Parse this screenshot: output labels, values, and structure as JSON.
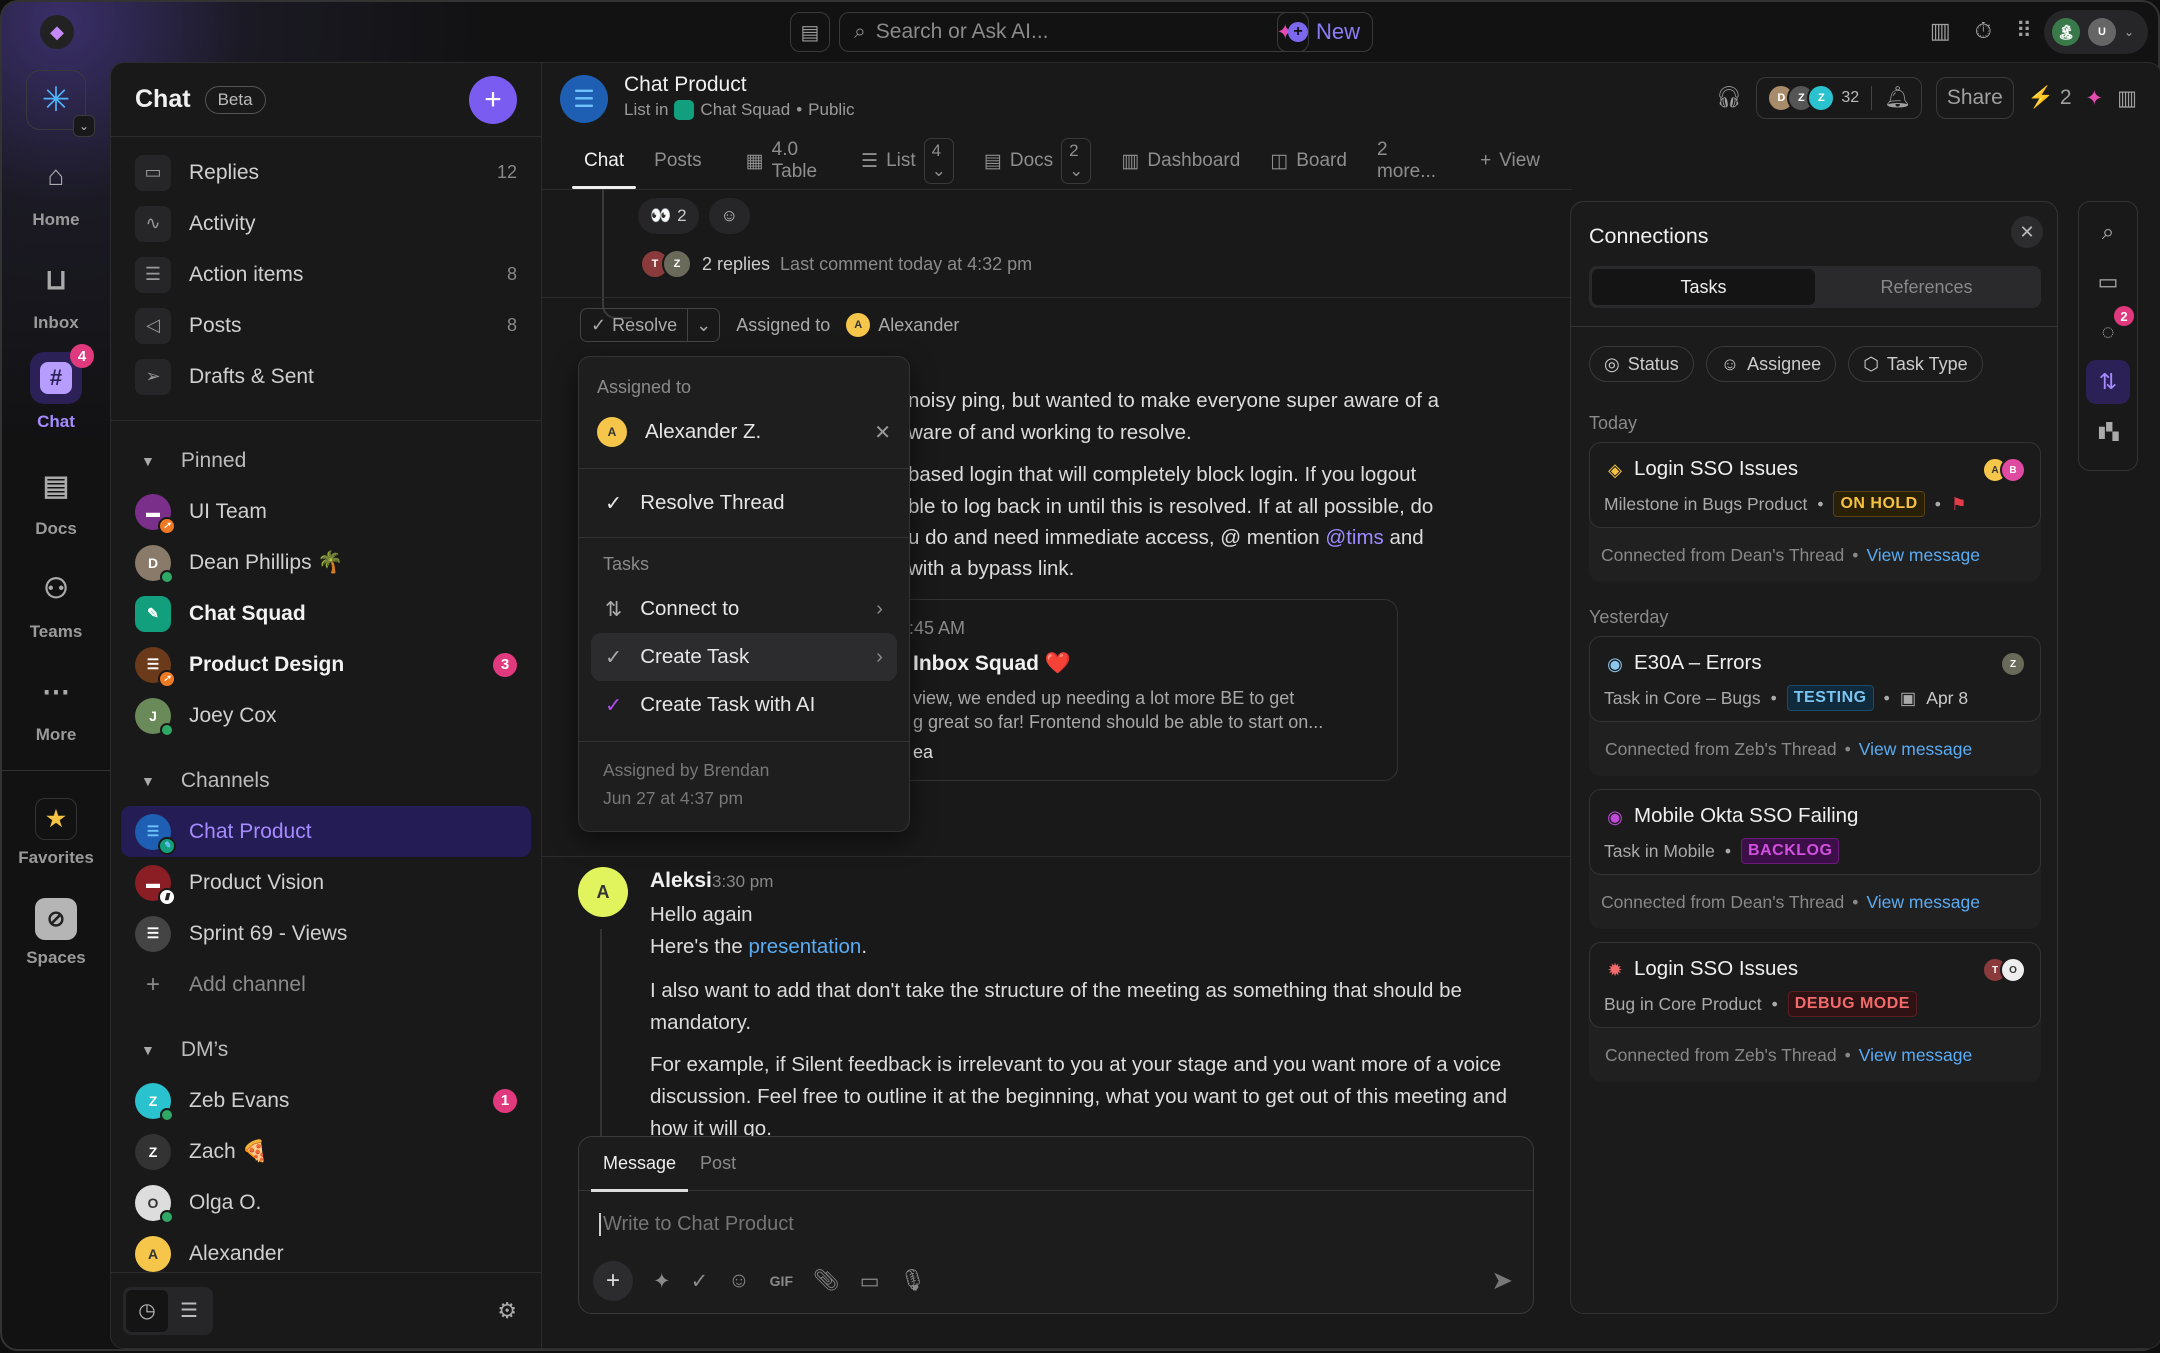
{
  "topbar": {
    "search_placeholder": "Search or Ask AI...",
    "new_label": "New"
  },
  "rail": {
    "items": [
      {
        "label": "Home",
        "icon": "home-icon"
      },
      {
        "label": "Inbox",
        "icon": "inbox-icon"
      },
      {
        "label": "Chat",
        "icon": "hash-icon",
        "badge": "4"
      },
      {
        "label": "Docs",
        "icon": "doc-icon"
      },
      {
        "label": "Teams",
        "icon": "teams-icon"
      },
      {
        "label": "More",
        "icon": "more-icon"
      }
    ],
    "favorites_label": "Favorites",
    "spaces_label": "Spaces"
  },
  "sidebar": {
    "title": "Chat",
    "beta_label": "Beta",
    "nav": [
      {
        "label": "Replies",
        "count": "12"
      },
      {
        "label": "Activity",
        "count": ""
      },
      {
        "label": "Action items",
        "count": "8"
      },
      {
        "label": "Posts",
        "count": "8"
      },
      {
        "label": "Drafts & Sent",
        "count": ""
      }
    ],
    "pinned_label": "Pinned",
    "pinned": [
      {
        "label": "UI Team"
      },
      {
        "label": "Dean Phillips 🌴"
      },
      {
        "label": "Chat Squad"
      },
      {
        "label": "Product Design",
        "badge": "3"
      },
      {
        "label": "Joey Cox"
      }
    ],
    "channels_label": "Channels",
    "channels": [
      {
        "label": "Chat Product"
      },
      {
        "label": "Product Vision"
      },
      {
        "label": "Sprint 69 - Views"
      }
    ],
    "add_channel_label": "Add channel",
    "dms_label": "DM’s",
    "dms": [
      {
        "label": "Zeb Evans",
        "badge": "1"
      },
      {
        "label": "Zach 🍕"
      },
      {
        "label": "Olga O."
      },
      {
        "label": "Alexander"
      }
    ]
  },
  "header": {
    "title": "Chat Product",
    "crumb_prefix": "List in",
    "crumb_space": "Chat Squad",
    "crumb_visibility": "Public",
    "member_count": "32",
    "share_label": "Share",
    "ai_count": "2"
  },
  "tabs": [
    {
      "label": "Chat",
      "active": true
    },
    {
      "label": "Posts"
    },
    {
      "label": "4.0 Table"
    },
    {
      "label": "List",
      "count": "4"
    },
    {
      "label": "Docs",
      "count": "2"
    },
    {
      "label": "Dashboard"
    },
    {
      "label": "Board"
    },
    {
      "label": "2 more..."
    },
    {
      "label": "View"
    }
  ],
  "thread": {
    "reaction_count": "2",
    "replies_label": "2 replies",
    "last_comment": "Last comment today at 4:32 pm",
    "resolve_label": "Resolve",
    "assigned_to_label": "Assigned to",
    "assignee": "Alexander",
    "body_lines": [
      "noisy ping, but wanted to make everyone super aware of a",
      "ware of and working to resolve.",
      "based login that will completely block login. If you logout",
      "ble to log back in until this is resolved. If at all possible, do",
      "u do and need immediate access, @ mention",
      "with a bypass link."
    ],
    "mention": "@tims",
    "mention_after": " and",
    "card": {
      "time": ":45 AM",
      "title": "Inbox Squad ❤️",
      "line1": "view, we ended up needing a lot more BE to get",
      "line2": "g great so far! Frontend should be able to start on...",
      "footer": "ea"
    }
  },
  "dropdown": {
    "assigned_to_label": "Assigned to",
    "assignee": "Alexander Z.",
    "resolve_thread": "Resolve Thread",
    "tasks_label": "Tasks",
    "connect_to": "Connect to",
    "create_task": "Create Task",
    "create_task_ai": "Create Task with AI",
    "assigned_by": "Assigned by Brendan",
    "assigned_date": "Jun 27 at 4:37 pm"
  },
  "message2": {
    "author": "Aleksi",
    "time": "3:30 pm",
    "line1": "Hello again",
    "line2_prefix": "Here's the ",
    "line2_link": "presentation",
    "line2_suffix": ".",
    "para1": "I also want to add that don't take the structure of the meeting as something that should be mandatory.",
    "para2": "For example, if Silent feedback is irrelevant to you at your stage and you want more of a voice discussion. Feel free to outline it at the beginning, what you want to get out of this meeting and how it will go."
  },
  "composer": {
    "tab_message": "Message",
    "tab_post": "Post",
    "placeholder": "Write to Chat Product"
  },
  "connections": {
    "title": "Connections",
    "tab_tasks": "Tasks",
    "tab_references": "References",
    "filters": [
      "Status",
      "Assignee",
      "Task Type"
    ],
    "groups": [
      {
        "label": "Today"
      },
      {
        "label": "Yesterday"
      }
    ],
    "cards": [
      {
        "title": "Login SSO Issues",
        "meta": "Milestone in Bugs Product",
        "status": "ON HOLD",
        "status_color": "#f5c242",
        "icon_color": "#f5c242",
        "connected": "Connected from Dean's Thread",
        "link": "View message",
        "flag": true
      },
      {
        "title": "E30A – Errors",
        "meta": "Task in Core – Bugs",
        "status": "TESTING",
        "status_color": "#7cc4f0",
        "icon_color": "#8cc8ee",
        "date": "Apr 8",
        "connected": "Connected from Zeb's Thread",
        "link": "View message"
      },
      {
        "title": "Mobile Okta SSO Failing",
        "meta": "Task in Mobile",
        "status": "BACKLOG",
        "status_color": "#d24fe0",
        "icon_color": "#c04bd8",
        "connected": "Connected from Dean's Thread",
        "link": "View message"
      },
      {
        "title": "Login SSO Issues",
        "meta": "Bug in Core Product",
        "status": "DEBUG MODE",
        "status_color": "#f26b6b",
        "icon_color": "#f26b6b",
        "connected": "Connected from Zeb's Thread",
        "link": "View message"
      }
    ]
  },
  "right_rail": {
    "tasks_badge": "2"
  }
}
